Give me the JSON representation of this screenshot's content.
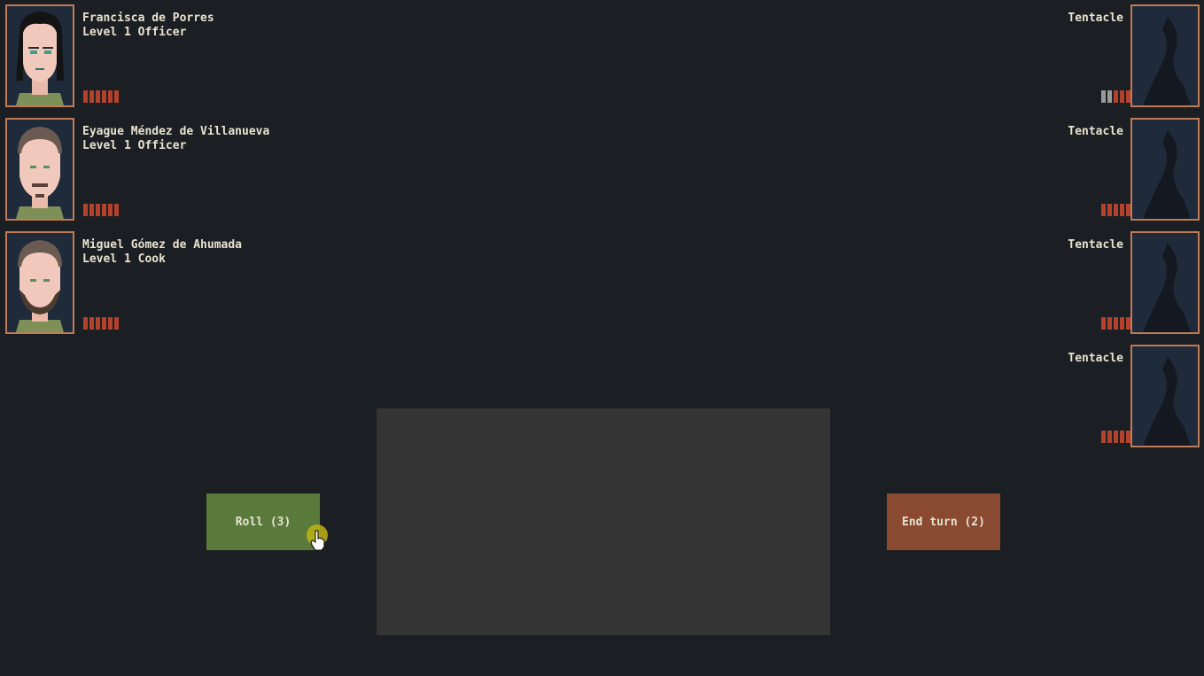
{
  "party": [
    {
      "name": "Francisca de Porres",
      "role": "Level 1 Officer",
      "hp_current": 6,
      "hp_max": 6
    },
    {
      "name": "Eyague Méndez de Villanueva",
      "role": "Level 1 Officer",
      "hp_current": 6,
      "hp_max": 6
    },
    {
      "name": "Miguel Gómez de Ahumada",
      "role": "Level 1 Cook",
      "hp_current": 6,
      "hp_max": 6
    }
  ],
  "enemies": [
    {
      "name": "Tentacle",
      "hp_current": 3,
      "hp_max": 5
    },
    {
      "name": "Tentacle",
      "hp_current": 5,
      "hp_max": 5
    },
    {
      "name": "Tentacle",
      "hp_current": 5,
      "hp_max": 5
    },
    {
      "name": "Tentacle",
      "hp_current": 5,
      "hp_max": 5
    }
  ],
  "actions": {
    "roll_label": "Roll (3)",
    "end_turn_label": "End turn (2)"
  },
  "colors": {
    "background": "#1b1e22",
    "hp_full": "#b3422d",
    "hp_empty": "#9a9a9a",
    "portrait_border": "#c07a55",
    "roll_button": "#5a7a3c",
    "end_turn_button": "#8a4a32"
  }
}
